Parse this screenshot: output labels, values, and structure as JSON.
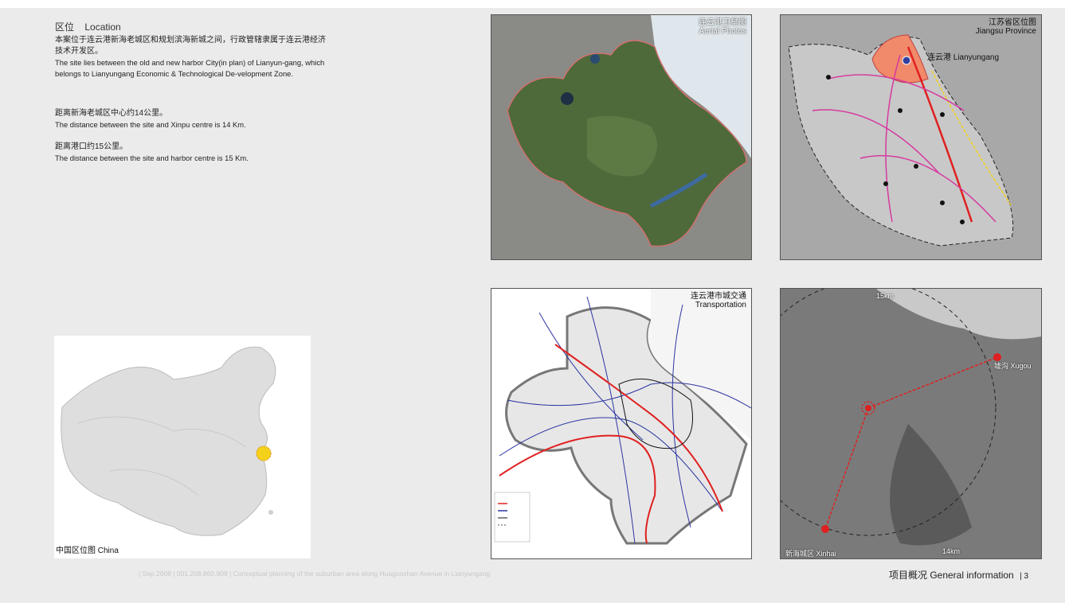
{
  "location": {
    "title_zh": "区位",
    "title_en": "Location",
    "p1_zh": "本案位于连云港新海老城区和规划滨海新城之间，行政管辖隶属于连云港经济技术开发区。",
    "p1_en": "The site lies between the old and new harbor City(in plan) of Lianyun-gang, which belongs to Lianyungang Economic & Technological De-velopment Zone.",
    "p2_zh": "距离新海老城区中心约14公里。",
    "p2_en": "The distance between the site and Xinpu centre is 14 Km.",
    "p3_zh": "距离港口约15公里。",
    "p3_en": "The distance between the site and harbor centre is 15 Km."
  },
  "panels": {
    "aerial": {
      "title_zh": "连云港卫星图",
      "title_en": "Aerial Photos"
    },
    "jiangsu": {
      "title_zh": "江苏省区位图",
      "title_en": "Jiangsu Province",
      "city_label": "连云港  Lianyungang"
    },
    "transport": {
      "title_zh": "连云港市城交通",
      "title_en": "Transportation"
    },
    "distance": {
      "top_label": "15km",
      "bottom_label": "14km",
      "xugou_label": "墟沟  Xugou",
      "xinhai_label": "新海城区  Xinhai"
    },
    "china": {
      "caption": "中国区位图  China"
    }
  },
  "colors": {
    "accent_red": "#e02020",
    "road_blue": "#2b35a0",
    "province_orange": "#f08a6a",
    "marker_yellow": "#f5d21a"
  },
  "footer": {
    "left": "| Sep 2008          | 001.208.860.809 | Conceptual planning of the suburban area along Huaguoshan Avenue in Lianyungang",
    "right_zh": "项目概况",
    "right_en": "General information",
    "page": "| 3"
  }
}
